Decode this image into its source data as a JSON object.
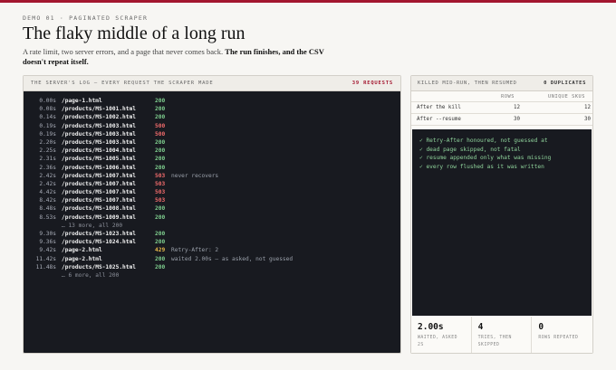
{
  "header": {
    "eyebrow": "DEMO 01 · PAGINATED SCRAPER",
    "title": "The flaky middle of a long run",
    "subtitle_plain": "A rate limit, two server errors, and a page that never comes back. ",
    "subtitle_bold": "The run finishes, and the CSV doesn't repeat itself."
  },
  "log_panel": {
    "heading": "THE SERVER'S LOG — EVERY REQUEST THE SCRAPER MADE",
    "count": "39 REQUESTS",
    "rows": [
      {
        "time": "0.00s",
        "path": "/page-1.html",
        "status": "200",
        "kind": "ok",
        "note": ""
      },
      {
        "time": "0.08s",
        "path": "/products/MS-1001.html",
        "status": "200",
        "kind": "ok",
        "note": ""
      },
      {
        "time": "0.14s",
        "path": "/products/MS-1002.html",
        "status": "200",
        "kind": "ok",
        "note": ""
      },
      {
        "time": "0.19s",
        "path": "/products/MS-1003.html",
        "status": "500",
        "kind": "err",
        "note": ""
      },
      {
        "time": "0.19s",
        "path": "/products/MS-1003.html",
        "status": "500",
        "kind": "err",
        "note": ""
      },
      {
        "time": "2.20s",
        "path": "/products/MS-1003.html",
        "status": "200",
        "kind": "ok",
        "note": ""
      },
      {
        "time": "2.25s",
        "path": "/products/MS-1004.html",
        "status": "200",
        "kind": "ok",
        "note": ""
      },
      {
        "time": "2.31s",
        "path": "/products/MS-1005.html",
        "status": "200",
        "kind": "ok",
        "note": ""
      },
      {
        "time": "2.36s",
        "path": "/products/MS-1006.html",
        "status": "200",
        "kind": "ok",
        "note": ""
      },
      {
        "time": "2.42s",
        "path": "/products/MS-1007.html",
        "status": "503",
        "kind": "err",
        "note": "never recovers"
      },
      {
        "time": "2.42s",
        "path": "/products/MS-1007.html",
        "status": "503",
        "kind": "err",
        "note": ""
      },
      {
        "time": "4.42s",
        "path": "/products/MS-1007.html",
        "status": "503",
        "kind": "err",
        "note": ""
      },
      {
        "time": "8.42s",
        "path": "/products/MS-1007.html",
        "status": "503",
        "kind": "err",
        "note": ""
      },
      {
        "time": "8.48s",
        "path": "/products/MS-1008.html",
        "status": "200",
        "kind": "ok",
        "note": ""
      },
      {
        "time": "8.53s",
        "path": "/products/MS-1009.html",
        "status": "200",
        "kind": "ok",
        "note": ""
      },
      {
        "skip": "… 13 more, all 200"
      },
      {
        "time": "9.30s",
        "path": "/products/MS-1023.html",
        "status": "200",
        "kind": "ok",
        "note": ""
      },
      {
        "time": "9.36s",
        "path": "/products/MS-1024.html",
        "status": "200",
        "kind": "ok",
        "note": ""
      },
      {
        "time": "9.42s",
        "path": "/page-2.html",
        "status": "429",
        "kind": "warn",
        "note": "Retry-After: 2"
      },
      {
        "time": "11.42s",
        "path": "/page-2.html",
        "status": "200",
        "kind": "ok",
        "note": "waited 2.00s — as asked, not guessed"
      },
      {
        "time": "11.48s",
        "path": "/products/MS-1025.html",
        "status": "200",
        "kind": "ok",
        "note": ""
      },
      {
        "skip": "… 6 more, all 200"
      }
    ]
  },
  "resume_panel": {
    "heading": "KILLED MID-RUN, THEN RESUMED",
    "duplicates": "0 DUPLICATES",
    "col_rows": "ROWS",
    "col_skus": "UNIQUE SKUS",
    "rows": [
      {
        "label": "After the kill",
        "rows": "12",
        "skus": "12"
      },
      {
        "label": "After --resume",
        "rows": "30",
        "skus": "30"
      }
    ],
    "checks": [
      "✓ Retry-After honoured, not guessed at",
      "✓ dead page skipped, not fatal",
      "✓ resume appended only what was missing",
      "✓ every row flushed as it was written"
    ],
    "stats": [
      {
        "value": "2.00s",
        "label": "WAITED, ASKED 2S"
      },
      {
        "value": "4",
        "label": "TRIES, THEN SKIPPED"
      },
      {
        "value": "0",
        "label": "ROWS REPEATED"
      }
    ]
  }
}
